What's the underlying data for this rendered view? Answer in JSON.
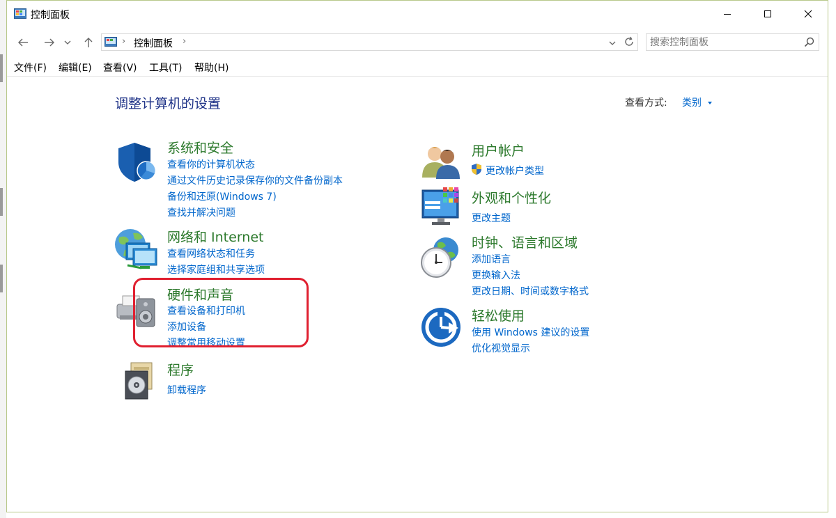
{
  "window": {
    "title": "控制面板",
    "controls": {
      "minimize": "minimize-icon",
      "maximize": "maximize-icon",
      "close": "close-icon"
    }
  },
  "address": {
    "breadcrumb": "控制面板",
    "search_placeholder": "搜索控制面板"
  },
  "menu": {
    "file": "文件(F)",
    "edit": "编辑(E)",
    "view": "查看(V)",
    "tools": "工具(T)",
    "help": "帮助(H)"
  },
  "main": {
    "heading": "调整计算机的设置",
    "view_by_label": "查看方式:",
    "view_by_value": "类别"
  },
  "categories": {
    "system": {
      "title": "系统和安全",
      "links": [
        "查看你的计算机状态",
        "通过文件历史记录保存你的文件备份副本",
        "备份和还原(Windows 7)",
        "查找并解决问题"
      ]
    },
    "network": {
      "title": "网络和 Internet",
      "links": [
        "查看网络状态和任务",
        "选择家庭组和共享选项"
      ]
    },
    "hardware": {
      "title": "硬件和声音",
      "links": [
        "查看设备和打印机",
        "添加设备",
        "调整常用移动设置"
      ]
    },
    "programs": {
      "title": "程序",
      "links": [
        "卸载程序"
      ]
    },
    "users": {
      "title": "用户帐户",
      "links": [
        "更改帐户类型"
      ]
    },
    "appearance": {
      "title": "外观和个性化",
      "links": [
        "更改主题"
      ]
    },
    "clock": {
      "title": "时钟、语言和区域",
      "links": [
        "添加语言",
        "更换输入法",
        "更改日期、时间或数字格式"
      ]
    },
    "ease": {
      "title": "轻松使用",
      "links": [
        "使用 Windows 建议的设置",
        "优化视觉显示"
      ]
    }
  },
  "colors": {
    "title_green": "#2d7a2d",
    "link_blue": "#0066cc",
    "heading_blue": "#1e3287",
    "annotation_red": "#e02030"
  }
}
